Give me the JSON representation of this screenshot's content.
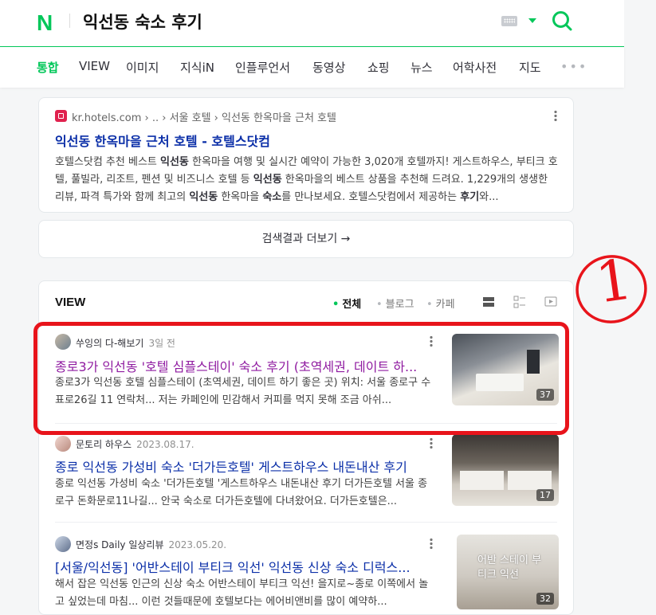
{
  "header": {
    "logo": "N",
    "query": "익선동 숙소 후기"
  },
  "tabs": [
    {
      "label": "통합",
      "active": true
    },
    {
      "label": "VIEW"
    },
    {
      "label": "이미지"
    },
    {
      "label": "지식iN"
    },
    {
      "label": "인플루언서"
    },
    {
      "label": "동영상"
    },
    {
      "label": "쇼핑"
    },
    {
      "label": "뉴스"
    },
    {
      "label": "어학사전"
    },
    {
      "label": "지도"
    }
  ],
  "result1": {
    "breadcrumb": "kr.hotels.com › .. › 서울 호텔 › 익선동 한옥마을 근처 호텔",
    "title": "익선동 한옥마을 근처 호텔 - 호텔스닷컴",
    "desc_parts": [
      [
        "호텔스닷컴 추천 베스트 ",
        false
      ],
      [
        "익선동",
        true
      ],
      [
        " 한옥마을 여행 및 실시간 예약이 가능한 3,020개 호텔까지! 게스트하우스, 부티크 호텔, 풀빌라, 리조트, 펜션 및 비즈니스 호텔 등 ",
        false
      ],
      [
        "익선동",
        true
      ],
      [
        " 한옥마을의 베스트 상품을 추천해 드려요. 1,229개의 생생한 리뷰, 파격 특가와 함께 최고의 ",
        false
      ],
      [
        "익선동",
        true
      ],
      [
        " 한옥마을 ",
        false
      ],
      [
        "숙소",
        true
      ],
      [
        "를 만나보세요. 호텔스닷컴에서 제공하는 ",
        false
      ],
      [
        "후기",
        true
      ],
      [
        "와...",
        false
      ]
    ]
  },
  "more_results": "검색결과 더보기 →",
  "view": {
    "title": "VIEW",
    "filters": [
      "전체",
      "블로그",
      "카페"
    ],
    "items": [
      {
        "author": "쑤잉의 다-해보기",
        "date": "3일 전",
        "title": "종로3가 익선동 '호텔 심플스테이' 숙소 후기 (초역세권, 데이트 하...",
        "desc": "종로3가 익선동 호텔 심플스테이 (초역세권, 데이트 하기 좋은 곳) 위치: 서울 종로구 수표로26길 11 연락처... 저는 카페인에 민감해서 커피를 먹지 못해 조금 아쉬...",
        "count": "37"
      },
      {
        "author": "문토리 하우스",
        "date": "2023.08.17.",
        "title": "종로 익선동 가성비 숙소 '더가든호텔' 게스트하우스 내돈내산 후기",
        "desc": "종로 익선동 가성비 숙소 '더가든호텔 '게스트하우스 내돈내산 후기 더가든호텔 서울 종로구 돈화문로11나길... 안국 숙소로 더가든호텔에 다녀왔어요. 더가든호텔은...",
        "count": "17"
      },
      {
        "author": "면정s Daily 일상리뷰",
        "date": "2023.05.20.",
        "title": "[서울/익선동] '어반스테이 부티크 익선' 익선동 신상 숙소 디럭스...",
        "desc": "해서 잡은 익선동 인근의 신상 숙소 어반스테이 부티크 익선! 을지로~종로 이쪽에서 놀고 싶었는데 마침... 이런 것들때문에 호텔보다는 에어비앤비를 많이 예약하...",
        "count": "32",
        "thumb_text": "어반 스테이 부티크 익선"
      }
    ]
  },
  "annotation": {
    "label": "1",
    "color": "#e8141b"
  }
}
